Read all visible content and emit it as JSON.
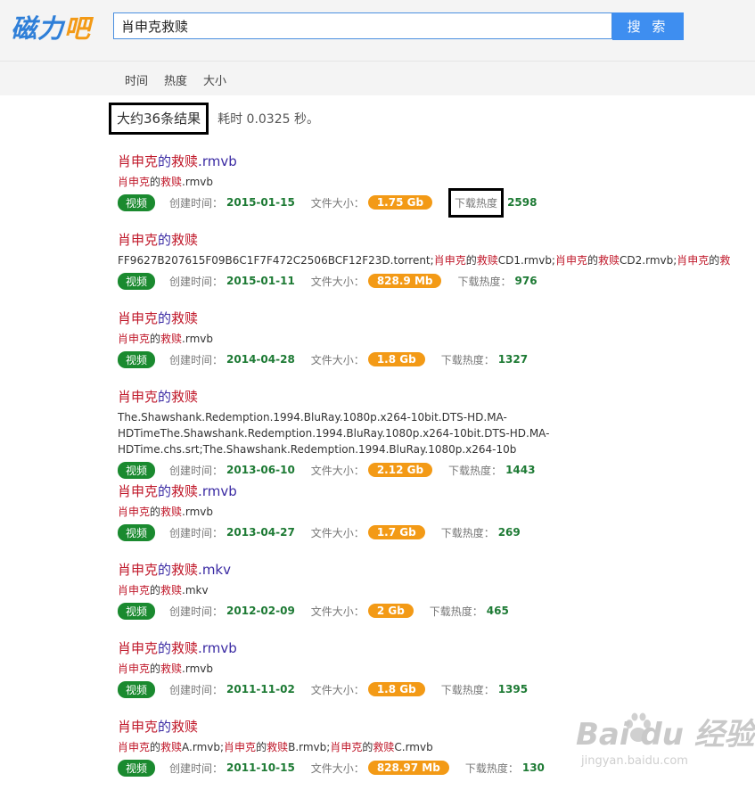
{
  "header": {
    "logo_part1": "磁力",
    "logo_part2": "吧",
    "search_value": "肖申克救赎",
    "search_button": "搜 索"
  },
  "sort": [
    "时间",
    "热度",
    "大小"
  ],
  "summary": {
    "count": "大约36条结果",
    "time": "耗时 0.0325 秒。"
  },
  "labels": {
    "created": "创建时间：",
    "size": "文件大小：",
    "heat": "下载热度：",
    "heat_boxed": "下载热度"
  },
  "results": [
    {
      "title": [
        [
          "h",
          "肖申克"
        ],
        [
          "n",
          "的"
        ],
        [
          "h",
          "救赎"
        ],
        [
          "n",
          ".rmvb"
        ]
      ],
      "files": [
        [
          "h",
          "肖申克"
        ],
        [
          "n",
          "的"
        ],
        [
          "h",
          "救赎"
        ],
        [
          "n",
          ".rmvb"
        ]
      ],
      "tag": "视频",
      "created": "2015-01-15",
      "size": "1.75 Gb",
      "heat": "2598"
    },
    {
      "title": [
        [
          "h",
          "肖申克"
        ],
        [
          "n",
          "的"
        ],
        [
          "h",
          "救赎"
        ]
      ],
      "files": [
        [
          "n",
          "FF9627B207615F09B6C1F7F472C2506BCF12F23D.torrent;"
        ],
        [
          "h",
          "肖申克"
        ],
        [
          "n",
          "的"
        ],
        [
          "h",
          "救赎"
        ],
        [
          "n",
          "CD1.rmvb;"
        ],
        [
          "h",
          "肖申克"
        ],
        [
          "n",
          "的"
        ],
        [
          "h",
          "救赎"
        ],
        [
          "n",
          "CD2.rmvb;"
        ],
        [
          "h",
          "肖申克"
        ],
        [
          "n",
          "的"
        ],
        [
          "h",
          "救"
        ]
      ],
      "tag": "视频",
      "created": "2015-01-11",
      "size": "828.9 Mb",
      "heat": "976"
    },
    {
      "title": [
        [
          "h",
          "肖申克"
        ],
        [
          "n",
          "的"
        ],
        [
          "h",
          "救赎"
        ]
      ],
      "files": [
        [
          "h",
          "肖申克"
        ],
        [
          "n",
          "的"
        ],
        [
          "h",
          "救赎"
        ],
        [
          "n",
          ".rmvb"
        ]
      ],
      "tag": "视频",
      "created": "2014-04-28",
      "size": "1.8 Gb",
      "heat": "1327"
    },
    {
      "title": [
        [
          "h",
          "肖申克"
        ],
        [
          "n",
          "的"
        ],
        [
          "h",
          "救赎"
        ]
      ],
      "files": [
        [
          "n",
          "The.Shawshank.Redemption.1994.BluRay.1080p.x264-10bit.DTS-HD.MA-HDTimeThe.Shawshank.Redemption.1994.BluRay.1080p.x264-10bit.DTS-HD.MA-HDTime.chs.srt;The.Shawshank.Redemption.1994.BluRay.1080p.x264-10b"
        ]
      ],
      "tag": "视频",
      "created": "2013-06-10",
      "size": "2.12 Gb",
      "heat": "1443"
    },
    {
      "title": [
        [
          "h",
          "肖申克"
        ],
        [
          "n",
          "的"
        ],
        [
          "h",
          "救赎"
        ],
        [
          "n",
          ".rmvb"
        ]
      ],
      "files": [
        [
          "h",
          "肖申克"
        ],
        [
          "n",
          "的"
        ],
        [
          "h",
          "救赎"
        ],
        [
          "n",
          ".rmvb"
        ]
      ],
      "tag": "视频",
      "created": "2013-04-27",
      "size": "1.7 Gb",
      "heat": "269"
    },
    {
      "title": [
        [
          "h",
          "肖申克"
        ],
        [
          "n",
          "的"
        ],
        [
          "h",
          "救赎"
        ],
        [
          "n",
          ".mkv"
        ]
      ],
      "files": [
        [
          "h",
          "肖申克"
        ],
        [
          "n",
          "的"
        ],
        [
          "h",
          "救赎"
        ],
        [
          "n",
          ".mkv"
        ]
      ],
      "tag": "视频",
      "created": "2012-02-09",
      "size": "2 Gb",
      "heat": "465"
    },
    {
      "title": [
        [
          "h",
          "肖申克"
        ],
        [
          "n",
          "的"
        ],
        [
          "h",
          "救赎"
        ],
        [
          "n",
          ".rmvb"
        ]
      ],
      "files": [
        [
          "h",
          "肖申克"
        ],
        [
          "n",
          "的"
        ],
        [
          "h",
          "救赎"
        ],
        [
          "n",
          ".rmvb"
        ]
      ],
      "tag": "视频",
      "created": "2011-11-02",
      "size": "1.8 Gb",
      "heat": "1395"
    },
    {
      "title": [
        [
          "h",
          "肖申克"
        ],
        [
          "n",
          "的"
        ],
        [
          "h",
          "救赎"
        ]
      ],
      "files": [
        [
          "h",
          "肖申克"
        ],
        [
          "n",
          "的"
        ],
        [
          "h",
          "救赎"
        ],
        [
          "n",
          "A.rmvb;"
        ],
        [
          "h",
          "肖申克"
        ],
        [
          "n",
          "的"
        ],
        [
          "h",
          "救赎"
        ],
        [
          "n",
          "B.rmvb;"
        ],
        [
          "h",
          "肖申克"
        ],
        [
          "n",
          "的"
        ],
        [
          "h",
          "救赎"
        ],
        [
          "n",
          "C.rmvb"
        ]
      ],
      "tag": "视频",
      "created": "2011-10-15",
      "size": "828.97 Mb",
      "heat": "130"
    }
  ],
  "watermark": {
    "brand": "Bai du 经验",
    "url": "jingyan.baidu.com"
  }
}
